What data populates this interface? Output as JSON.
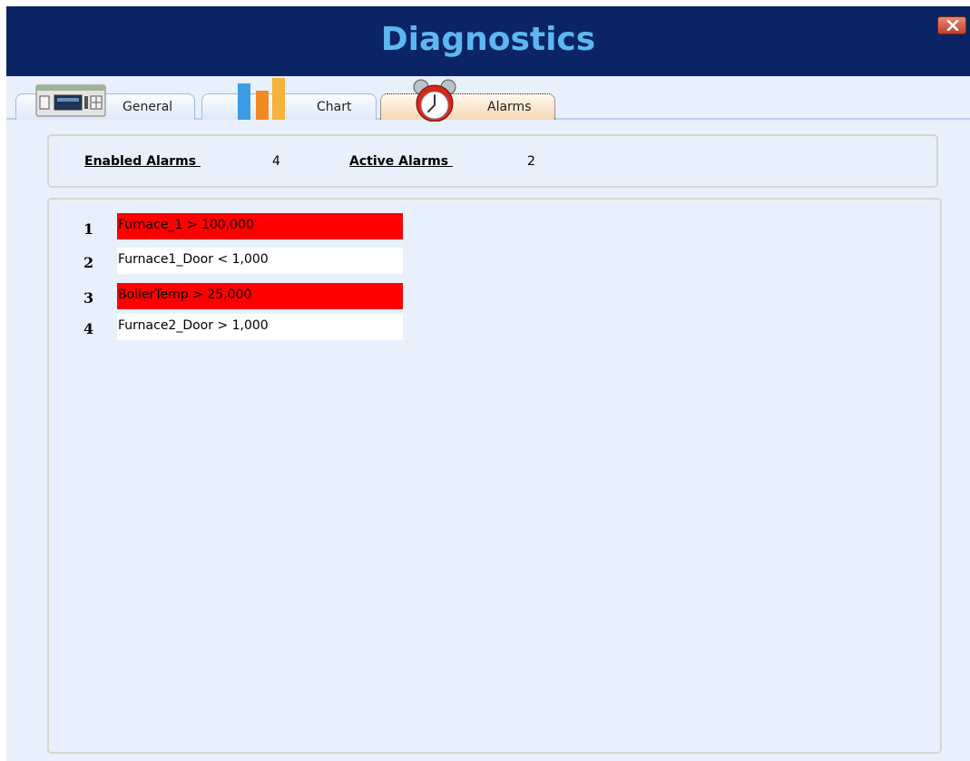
{
  "window": {
    "title": "Diagnostics",
    "close_icon": "close-x-icon"
  },
  "tabs": [
    {
      "label": "General",
      "icon": "plc-device-icon",
      "active": false
    },
    {
      "label": "Chart",
      "icon": "bar-chart-icon",
      "active": false
    },
    {
      "label": "Alarms",
      "icon": "alarm-clock-icon",
      "active": true
    }
  ],
  "summary": {
    "enabled_label": "Enabled Alarms ",
    "enabled_value": "4",
    "active_label": "Active Alarms ",
    "active_value": "2"
  },
  "alarms": [
    {
      "index": "1",
      "text": "Furnace_1 > 100,000",
      "active": true
    },
    {
      "index": "2",
      "text": "Furnace1_Door < 1,000",
      "active": false
    },
    {
      "index": "3",
      "text": "BoilerTemp > 25,000",
      "active": true
    },
    {
      "index": "4",
      "text": "Furnace2_Door > 1,000",
      "active": false
    }
  ],
  "colors": {
    "title_bar": "#0a2464",
    "title_text": "#5db7f1",
    "alarm_active": "#ff0000",
    "alarm_inactive": "#ffffff",
    "panel_background": "#e8f0fb"
  }
}
